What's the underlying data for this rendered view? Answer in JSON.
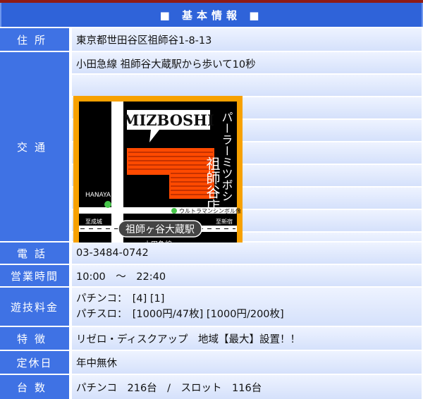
{
  "header": {
    "title": "■ 基本情報 ■"
  },
  "rows": {
    "address": {
      "label": "住所",
      "value": "東京都世田谷区祖師谷1-8-13"
    },
    "transport": {
      "label": "交通",
      "value": "小田急線 祖師谷大蔵駅から歩いて10秒"
    },
    "phone": {
      "label": "電話",
      "value": "03-3484-0742"
    },
    "hours": {
      "label": "営業時間",
      "value": "10:00　～　22:40"
    },
    "fees": {
      "label": "遊技料金",
      "line1": "パチンコ：　[4] [1]",
      "line2": "パチスロ：　[1000円/47枚] [1000円/200枚]"
    },
    "features": {
      "label": "特徴",
      "value": "リゼロ・ディスクアップ　地域【最大】設置！！"
    },
    "holiday": {
      "label": "定休日",
      "value": "年中無休"
    },
    "machines": {
      "label": "台数",
      "value": "パチンコ　216台　/　スロット　116台"
    }
  },
  "map": {
    "brand": "MIZBOSHI",
    "shop_name": "パーラーミツボシ",
    "branch": "祖師谷店",
    "hanaya": "HANAYA",
    "landmark": "ウルトラマンシンボル像",
    "to_seijo": "至成城",
    "to_shinjuku": "至新宿",
    "station": "祖師ヶ谷大蔵駅",
    "line": "小田急線",
    "colors": {
      "frame": "#f7a100",
      "building": "#ff4a00",
      "dot": "#47c64a"
    }
  }
}
